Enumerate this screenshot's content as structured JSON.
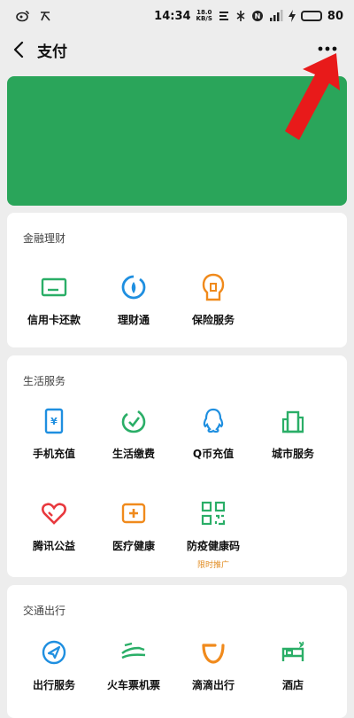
{
  "status_bar": {
    "time": "14:34",
    "net_speed_value": "18.0",
    "net_speed_unit": "KB/S",
    "battery_level": "80",
    "colors": {
      "battery_fill": "#4cc24c"
    }
  },
  "header": {
    "title": "支付",
    "back_icon": "chevron-left-icon",
    "more_icon": "more-dots-icon"
  },
  "banner": {
    "color": "#2aa55a"
  },
  "annotation": {
    "arrow_color": "#e81a1a",
    "arrow_icon": "red-arrow-pointer"
  },
  "sections": [
    {
      "title": "金融理财",
      "items": [
        {
          "label": "信用卡还款",
          "icon": "credit-card-icon"
        },
        {
          "label": "理财通",
          "icon": "wealth-icon"
        },
        {
          "label": "保险服务",
          "icon": "insurance-icon"
        }
      ]
    },
    {
      "title": "生活服务",
      "items": [
        {
          "label": "手机充值",
          "icon": "phone-recharge-icon"
        },
        {
          "label": "生活缴费",
          "icon": "utility-payment-icon"
        },
        {
          "label": "Q币充值",
          "icon": "qq-coin-icon"
        },
        {
          "label": "城市服务",
          "icon": "city-service-icon"
        },
        {
          "label": "腾讯公益",
          "icon": "charity-heart-icon"
        },
        {
          "label": "医疗健康",
          "icon": "medical-icon"
        },
        {
          "label": "防疫健康码",
          "icon": "qr-code-icon",
          "sub": "限时推广"
        }
      ]
    },
    {
      "title": "交通出行",
      "items": [
        {
          "label": "出行服务",
          "icon": "navigation-icon"
        },
        {
          "label": "火车票机票",
          "icon": "train-ticket-icon"
        },
        {
          "label": "滴滴出行",
          "icon": "didi-icon"
        },
        {
          "label": "酒店",
          "icon": "hotel-icon"
        }
      ]
    }
  ]
}
